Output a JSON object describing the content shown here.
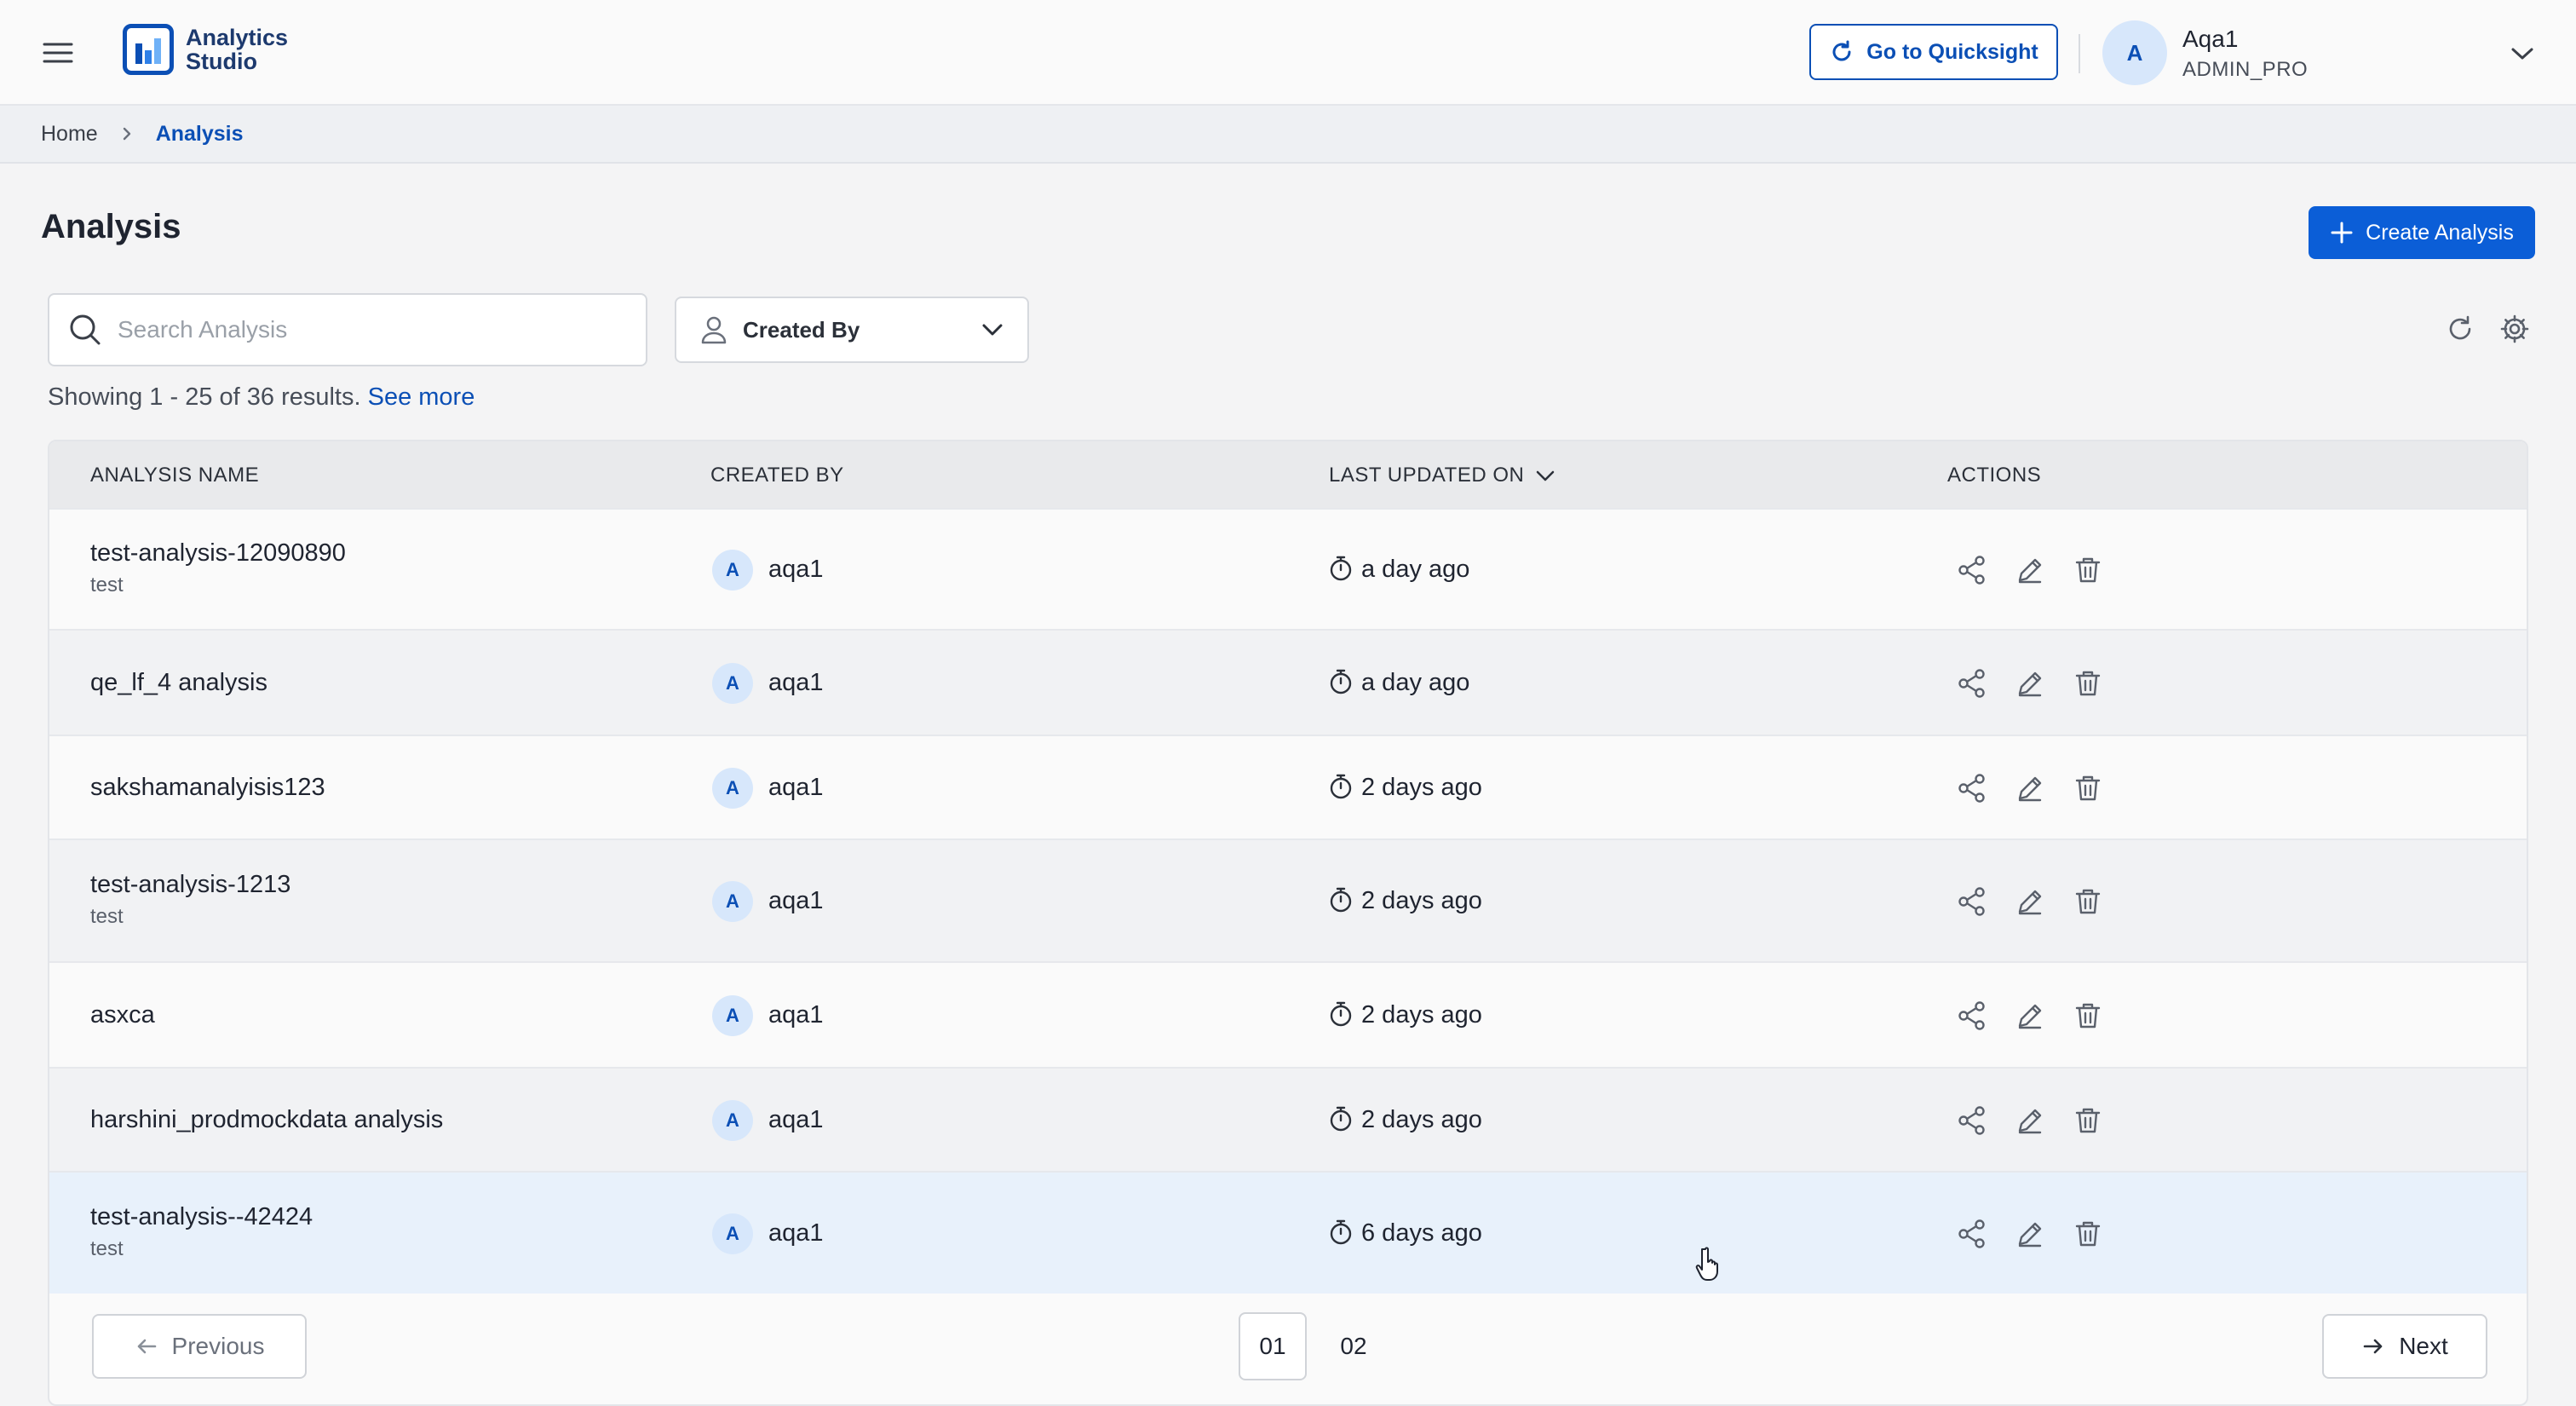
{
  "app": {
    "logo_line1": "Analytics",
    "logo_line2": "Studio",
    "quicksight_label": "Go to Quicksight",
    "user_initial": "A",
    "user_name": "Aqa1",
    "user_role": "ADMIN_PRO"
  },
  "breadcrumb": {
    "home": "Home",
    "current": "Analysis"
  },
  "page": {
    "title": "Analysis",
    "create_label": "Create Analysis",
    "search_placeholder": "Search Analysis",
    "created_by_label": "Created By",
    "results_text": "Showing 1 - 25 of 36 results.",
    "see_more": "See more"
  },
  "table": {
    "columns": [
      "ANALYSIS NAME",
      "CREATED BY",
      "LAST UPDATED ON",
      "ACTIONS"
    ],
    "rows": [
      {
        "name": "test-analysis-12090890",
        "sub": "test",
        "initial": "A",
        "user": "aqa1",
        "updated": "a day ago"
      },
      {
        "name": "qe_lf_4 analysis",
        "sub": "",
        "initial": "A",
        "user": "aqa1",
        "updated": "a day ago"
      },
      {
        "name": "sakshamanalyisis123",
        "sub": "",
        "initial": "A",
        "user": "aqa1",
        "updated": "2 days ago"
      },
      {
        "name": "test-analysis-1213",
        "sub": "test",
        "initial": "A",
        "user": "aqa1",
        "updated": "2 days ago"
      },
      {
        "name": "asxca",
        "sub": "",
        "initial": "A",
        "user": "aqa1",
        "updated": "2 days ago"
      },
      {
        "name": "harshini_prodmockdata analysis",
        "sub": "",
        "initial": "A",
        "user": "aqa1",
        "updated": "2 days ago"
      },
      {
        "name": "test-analysis--42424",
        "sub": "test",
        "initial": "A",
        "user": "aqa1",
        "updated": "6 days ago"
      }
    ]
  },
  "pagination": {
    "previous": "Previous",
    "next": "Next",
    "pages": [
      "01",
      "02"
    ],
    "current_page": "01"
  },
  "colors": {
    "primary": "#0b5ed7",
    "brand": "#0b4fb5",
    "avatar_bg": "#d7e7fb",
    "row_highlight": "#e8f1fb"
  }
}
